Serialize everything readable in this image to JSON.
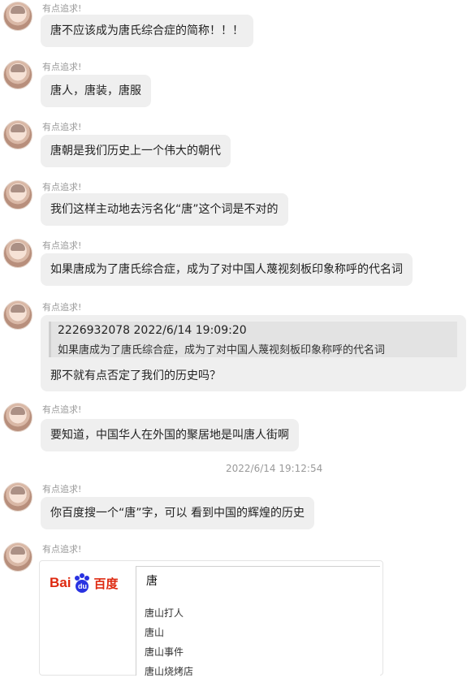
{
  "chat": {
    "sender_name": "有点追求!",
    "messages": [
      {
        "text": "唐不应该成为唐氏综合症的简称！！！"
      },
      {
        "text": "唐人，唐装，唐服"
      },
      {
        "text": "唐朝是我们历史上一个伟大的朝代"
      },
      {
        "text": "我们这样主动地去污名化“唐”这个词是不对的"
      },
      {
        "text": "如果唐成为了唐氏综合症，成为了对中国人蔑视刻板印象称呼的代名词"
      },
      {
        "quote": {
          "header": "2226932078  2022/6/14 19:09:20",
          "text": "如果唐成为了唐氏综合症，成为了对中国人蔑视刻板印象称呼的代名词"
        },
        "text": "那不就有点否定了我们的历史吗？"
      },
      {
        "text": "要知道，中国华人在外国的聚居地是叫唐人街啊"
      },
      {
        "text": "你百度搜一个“唐”字，可以 看到中国的辉煌的历史"
      }
    ],
    "timestamp": "2022/6/14 19:12:54"
  },
  "baidu_card": {
    "logo_latin": "Bai",
    "logo_paw_text": "du",
    "logo_cn": "百度",
    "search_value": "唐",
    "suggestions": [
      "唐山打人",
      "唐山",
      "唐山事件",
      "唐山烧烤店"
    ]
  }
}
